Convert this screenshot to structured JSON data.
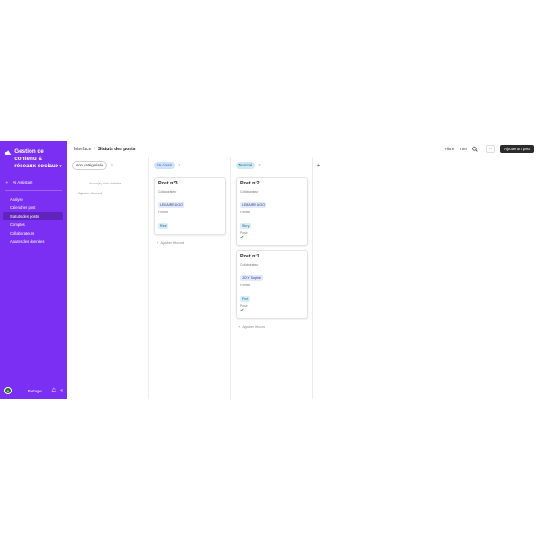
{
  "sidebar": {
    "base_name": "Gestion de contenu & réseaux sociaux",
    "assistant_label": "AI Assistant",
    "items": [
      {
        "label": "Analyse",
        "active": false
      },
      {
        "label": "Calendrier post",
        "active": false
      },
      {
        "label": "Statuts des posts",
        "active": true
      },
      {
        "label": "Comptes",
        "active": false
      },
      {
        "label": "Collaborateurs",
        "active": false
      },
      {
        "label": "Ajouter des données",
        "active": false
      }
    ],
    "avatar_initial": "B",
    "share_label": "Partager",
    "accent_color": "#7b2ff2"
  },
  "topbar": {
    "breadcrumb_root": "Interface",
    "breadcrumb_current": "Statuts des posts",
    "filter_label": "Filtre",
    "sort_label": "Trier",
    "more_label": "···",
    "add_button_label": "Ajouter un post"
  },
  "board": {
    "add_record_label": "Ajouter ifécord",
    "columns": [
      {
        "status": "Non catégorisée",
        "count": "0",
        "empty_hint": "Aucun(e) fiche détaillée",
        "cards": []
      },
      {
        "status": "En cours",
        "count": "1",
        "cards": [
          {
            "title": "Post n°3",
            "collab_label": "Collaborateur",
            "collab": "LEMAIRE UGO",
            "format_label": "Format",
            "format": "Reel"
          }
        ]
      },
      {
        "status": "Terminé",
        "count": "2",
        "cards": [
          {
            "title": "Post n°2",
            "collab_label": "Collaborateur",
            "collab": "LEMAIRE UGO",
            "format_label": "Format",
            "format": "Story",
            "posted_label": "Posté"
          },
          {
            "title": "Post n°1",
            "collab_label": "Collaborateur",
            "collab": "JOLY Sophie",
            "format_label": "Format",
            "format": "Post",
            "posted_label": "Posté"
          }
        ]
      }
    ]
  }
}
